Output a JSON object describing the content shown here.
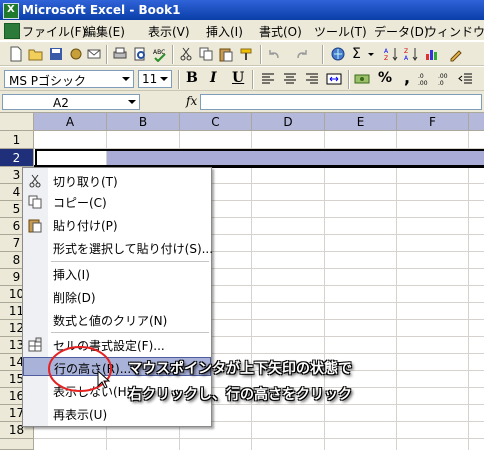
{
  "window": {
    "title": "Microsoft Excel - Book1"
  },
  "menubar": {
    "items": [
      "ファイル(F)",
      "編集(E)",
      "表示(V)",
      "挿入(I)",
      "書式(O)",
      "ツール(T)",
      "データ(D)",
      "ウィンドウ(W)"
    ]
  },
  "format_toolbar": {
    "font_name": "MS Pゴシック",
    "font_size": "11",
    "bold": "B",
    "italic": "I",
    "underline": "U",
    "percent": "%",
    "comma": ","
  },
  "standard_toolbar": {
    "sigma": "Σ"
  },
  "formula_bar": {
    "name_box": "A2",
    "fx": "fx"
  },
  "grid": {
    "columns": [
      "A",
      "B",
      "C",
      "D",
      "E",
      "F"
    ],
    "rows": [
      "1",
      "2",
      "3",
      "4",
      "5",
      "6",
      "7",
      "8",
      "9",
      "10",
      "11",
      "12",
      "13",
      "14",
      "15",
      "16",
      "17",
      "18"
    ],
    "selected_row": "2"
  },
  "context_menu": {
    "items": [
      "切り取り(T)",
      "コピー(C)",
      "貼り付け(P)",
      "形式を選択して貼り付け(S)...",
      "挿入(I)",
      "削除(D)",
      "数式と値のクリア(N)",
      "セルの書式設定(F)...",
      "行の高さ(R)...",
      "表示しない(H)",
      "再表示(U)"
    ],
    "highlighted": "行の高さ(R)..."
  },
  "annotation": {
    "line1": "マウスポインタが上下矢印の状態で",
    "line2": "右クリックし、行の高さをクリック"
  },
  "colors": {
    "title_bar": "#0a3ea8",
    "selection": "#b4b8db",
    "highlight": "#a9b2d8",
    "callout_circle": "#e52222"
  }
}
